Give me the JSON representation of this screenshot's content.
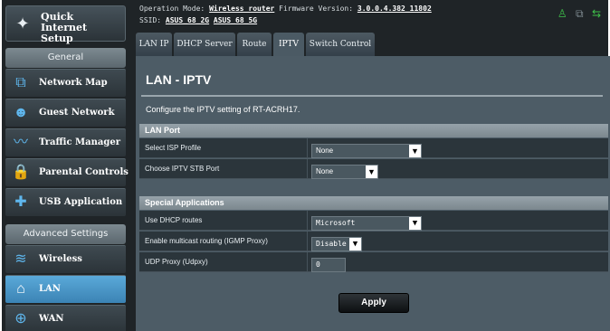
{
  "sidebar": {
    "qis_label": "Quick Internet Setup",
    "general_header": "General",
    "advanced_header": "Advanced Settings",
    "general_items": [
      {
        "label": "Network Map",
        "icon": "network-map-icon"
      },
      {
        "label": "Guest Network",
        "icon": "guest-network-icon"
      },
      {
        "label": "Traffic Manager",
        "icon": "traffic-manager-icon"
      },
      {
        "label": "Parental Controls",
        "icon": "parental-controls-icon"
      },
      {
        "label": "USB Application",
        "icon": "usb-application-icon"
      }
    ],
    "advanced_items": [
      {
        "label": "Wireless",
        "icon": "wireless-icon"
      },
      {
        "label": "LAN",
        "icon": "lan-icon",
        "active": true
      },
      {
        "label": "WAN",
        "icon": "wan-icon"
      }
    ]
  },
  "topbar": {
    "opmode_label": "Operation Mode:",
    "opmode_value": "Wireless router",
    "firmware_label": "Firmware Version:",
    "firmware_value": "3.0.0.4.382_11802",
    "ssid_label": "SSID:",
    "ssid_2g": "ASUS_68_2G",
    "ssid_5g": "ASUS_68_5G"
  },
  "tabs": [
    "LAN IP",
    "DHCP Server",
    "Route",
    "IPTV",
    "Switch Control"
  ],
  "active_tab": "IPTV",
  "page": {
    "title": "LAN - IPTV",
    "description": "Configure the IPTV setting of RT-ACRH17."
  },
  "lan_port": {
    "header": "LAN Port",
    "isp_profile_label": "Select ISP Profile",
    "isp_profile_value": "None",
    "stb_port_label": "Choose IPTV STB Port",
    "stb_port_value": "None"
  },
  "special_apps": {
    "header": "Special Applications",
    "dhcp_routes_label": "Use DHCP routes",
    "dhcp_routes_value": "Microsoft",
    "multicast_label": "Enable multicast routing (IGMP Proxy)",
    "multicast_value": "Disable",
    "udp_proxy_label": "UDP Proxy (Udpxy)",
    "udp_proxy_value": "0"
  },
  "apply_label": "Apply",
  "colors": {
    "background": "#1f2427",
    "panel": "#4d5c66",
    "accent_active": "#4a97c9",
    "status_green": "#3fc14a"
  }
}
